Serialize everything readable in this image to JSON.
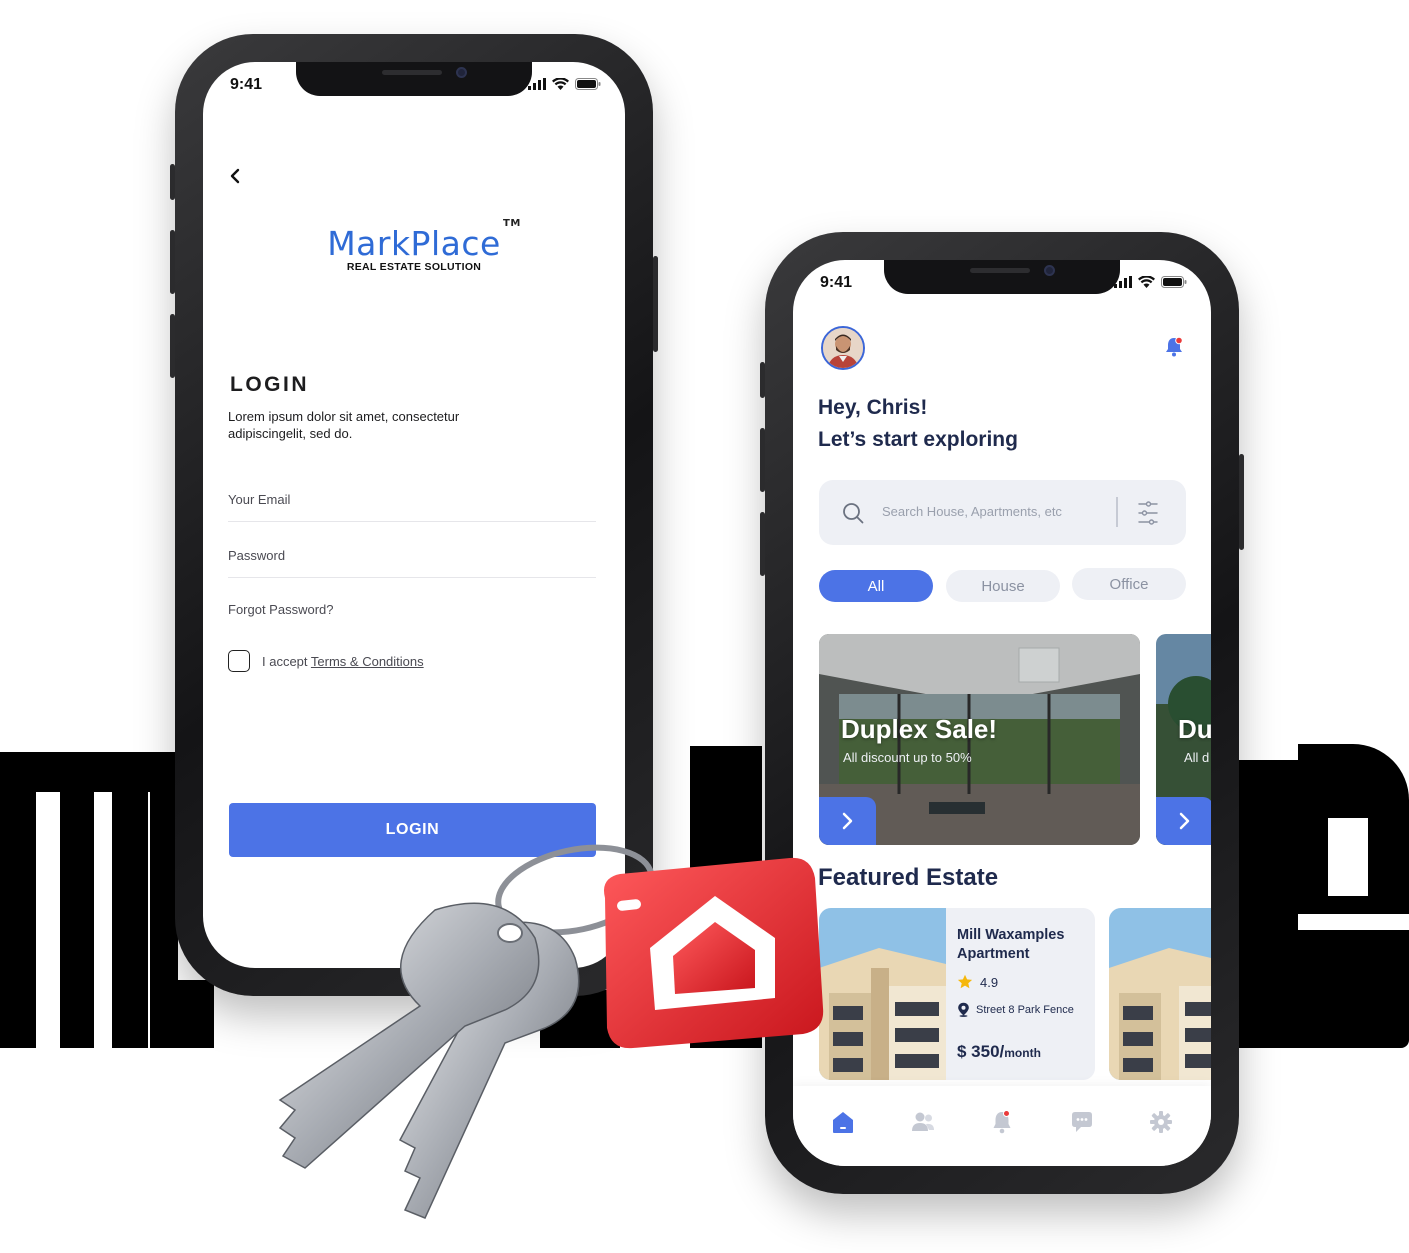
{
  "login_screen": {
    "status_time": "9:41",
    "logo": {
      "name": "MarkPlace",
      "tm": "TM",
      "tagline": "REAL ESTATE SOLUTION"
    },
    "title": "LOGIN",
    "description": "Lorem ipsum dolor sit amet, consectetur adipiscingelit, sed do.",
    "email_placeholder": "Your Email",
    "password_placeholder": "Password",
    "forgot_password": "Forgot Password?",
    "terms_prefix": "I accept",
    "terms_link": "Terms & Conditions",
    "login_button": "LOGIN"
  },
  "home_screen": {
    "status_time": "9:41",
    "greeting": "Hey, Chris!",
    "greeting_sub": "Let’s start exploring",
    "search_placeholder": "Search House, Apartments, etc",
    "filters": [
      {
        "label": "All",
        "active": true
      },
      {
        "label": "House",
        "active": false
      },
      {
        "label": "Office",
        "active": false
      }
    ],
    "promos": [
      {
        "title": "Duplex Sale!",
        "subtitle": "All discount up to 50%"
      },
      {
        "title": "Du",
        "subtitle": "All d"
      }
    ],
    "featured_title": "Featured Estate",
    "featured": [
      {
        "name": "Mill Waxamples Apartment",
        "rating": "4.9",
        "location": "Street 8 Park Fence",
        "price": "$ 350/",
        "period": "month"
      }
    ],
    "tabs": [
      "home-icon",
      "people-icon",
      "bell-icon",
      "chat-icon",
      "gear-icon"
    ]
  },
  "colors": {
    "accent": "#4c73e6",
    "navy": "#1f2a4d",
    "chip_bg": "#eef0f5",
    "key_tag": "#e8343a"
  }
}
